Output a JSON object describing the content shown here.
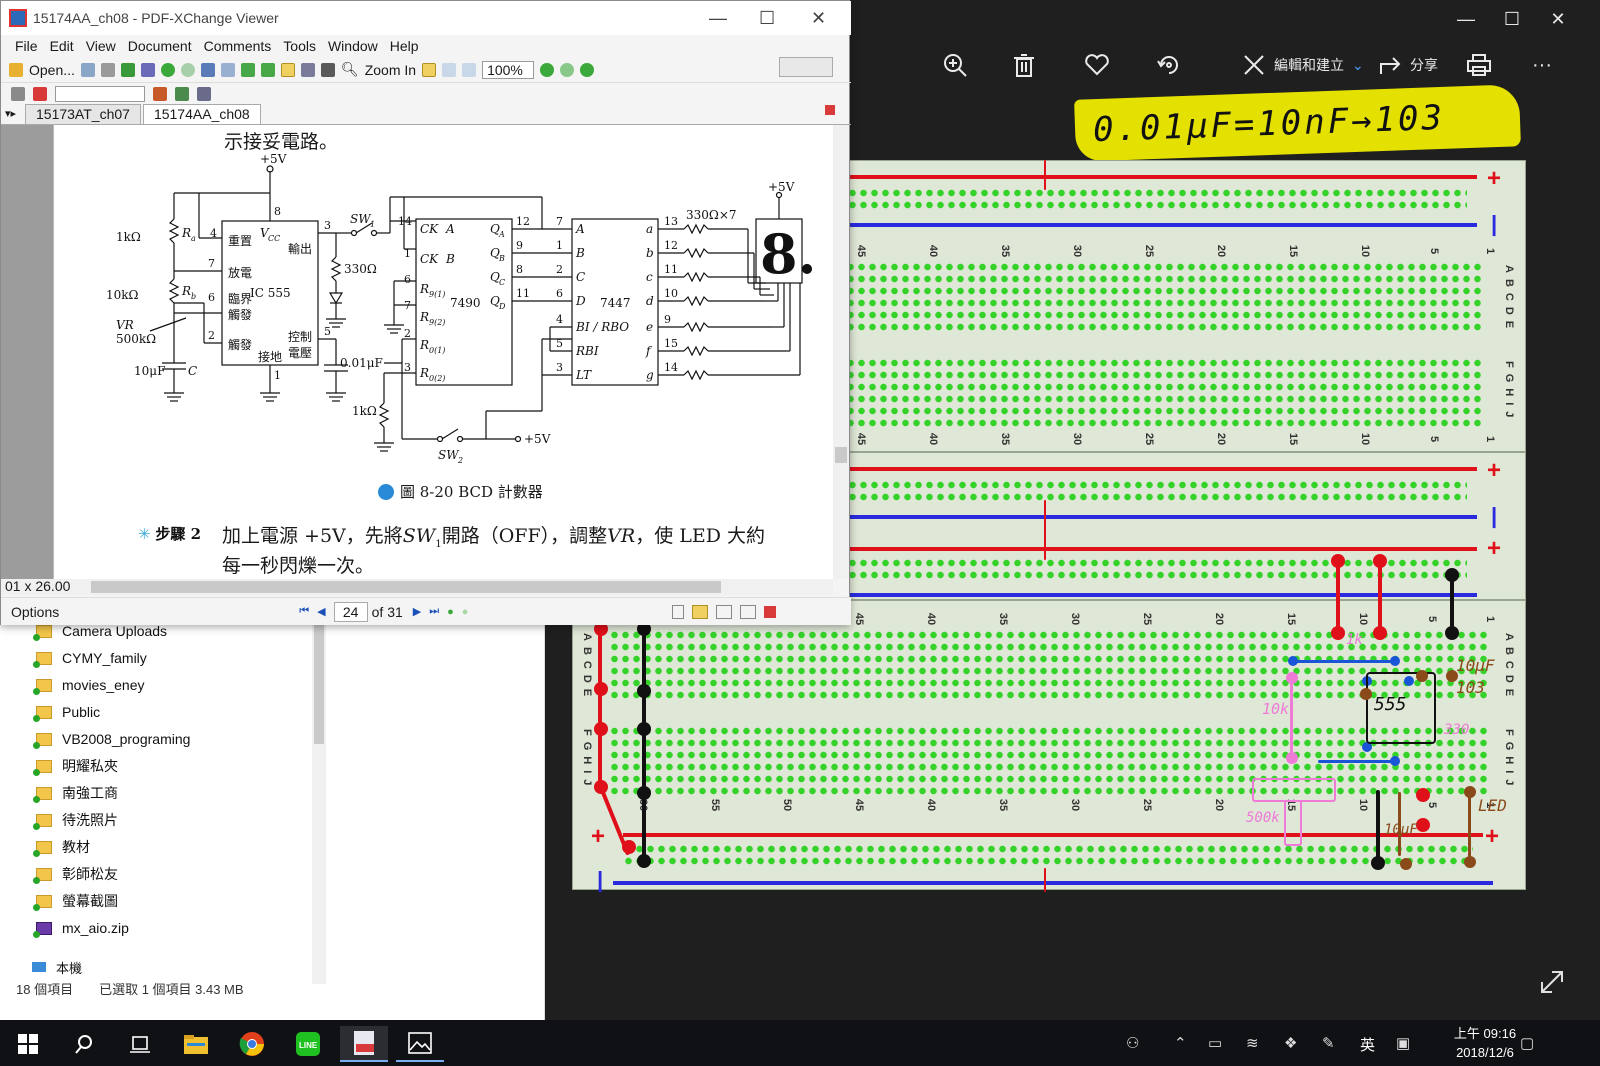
{
  "pdf": {
    "title": "15174AA_ch08 - PDF-XChange Viewer",
    "menu": [
      "File",
      "Edit",
      "View",
      "Document",
      "Comments",
      "Tools",
      "Window",
      "Help"
    ],
    "toolbar": {
      "open_label": "Open...",
      "zoom_in_label": "Zoom In",
      "zoom_value": "100%"
    },
    "tabs": [
      "15173AT_ch07",
      "15174AA_ch08"
    ],
    "doc": {
      "top_text": "示接妥電路。",
      "schematic": {
        "vcc_top": "+5V",
        "r_a": "1kΩ",
        "r_a_name": "R",
        "r_a_sub": "a",
        "r_b": "10kΩ",
        "r_b_name": "R",
        "r_b_sub": "b",
        "vr": "VR",
        "vr_value": "500kΩ",
        "cap_c": "10μF",
        "cap_c_name": "C",
        "ic555_name": "IC 555",
        "ic555_pins": {
          "reset": "重置",
          "vcc": "V",
          "vcc_sub": "CC",
          "output": "輸出",
          "discharge": "放電",
          "threshold": "臨界",
          "trigger_a": "觸發",
          "trigger_b": "觸發",
          "control": "控制",
          "voltage": "電壓",
          "ground": "接地"
        },
        "pin_numbers_555": [
          "4",
          "8",
          "3",
          "7",
          "6",
          "2",
          "5",
          "1"
        ],
        "sw1": "SW",
        "sw1_sub": "1",
        "r330": "330Ω",
        "cap001": "0.01μF",
        "ic7490_name": "7490",
        "ic7490_inputs": [
          "CK",
          "A",
          "CK",
          "B",
          "R",
          "9(1)",
          "R",
          "9(2)",
          "R",
          "0(1)",
          "R",
          "0(2)"
        ],
        "ic7490_outputs": [
          "Q",
          "A",
          "Q",
          "B",
          "Q",
          "C",
          "Q",
          "D"
        ],
        "pin_numbers_7490_in": [
          "14",
          "1",
          "6",
          "7",
          "2",
          "3"
        ],
        "pin_numbers_7490_out": [
          "12",
          "9",
          "8",
          "11"
        ],
        "ic7447_name": "7447",
        "ic7447_inputs": [
          "A",
          "B",
          "C",
          "D",
          "BI / RBO",
          "RBI",
          "LT"
        ],
        "ic7447_in_pins": [
          "7",
          "1",
          "2",
          "6",
          "4",
          "5",
          "3"
        ],
        "ic7447_outputs": [
          "a",
          "b",
          "c",
          "d",
          "e",
          "f",
          "g"
        ],
        "ic7447_out_pins": [
          "13",
          "12",
          "11",
          "10",
          "9",
          "15",
          "14"
        ],
        "r_array": "330Ω×7",
        "display_vcc": "+5V",
        "r1k": "1kΩ",
        "sw2": "SW",
        "sw2_sub": "2",
        "vcc_right": "+5V"
      },
      "figure_caption": "圖 8-20  BCD 計數器",
      "step_label": "步驟 2",
      "step_text_1a": "加上電源 +5V，先將",
      "step_text_1b": "SW",
      "step_text_1c": "1",
      "step_text_1d": "開路（OFF），調整",
      "step_text_1e": "VR",
      "step_text_1f": "，使 LED 大約",
      "step_text_2": "每一秒閃爍一次。"
    },
    "page_size": "01 x 26.00",
    "status": {
      "options_label": "Options",
      "page_current": "24",
      "page_total": "of 31"
    }
  },
  "explorer": {
    "folders": [
      "Camera Uploads",
      "CYMY_family",
      "movies_eney",
      "Public",
      "VB2008_programing",
      "明耀私夾",
      "南強工商",
      "待洗照片",
      "教材",
      "彰師松友",
      "螢幕截圖",
      "mx_aio.zip"
    ],
    "this_pc": "本機",
    "item_count": "18 個項目",
    "selected": "已選取 1 個項目  3.43 MB"
  },
  "photos": {
    "edit_label": "編輯和建立",
    "share_label": "分享",
    "handwritten_note": "0.01μF=10nF→103",
    "numbers_upper": [
      "45",
      "40",
      "35",
      "30",
      "25",
      "20",
      "15",
      "10",
      "5",
      "1"
    ],
    "numbers_lower": [
      "60",
      "55",
      "50",
      "45",
      "40",
      "35",
      "30",
      "25",
      "20",
      "15",
      "10",
      "5",
      "1"
    ],
    "letters_abcde": "ABCDE",
    "letters_fghij": "FGHIJ",
    "annotations": {
      "r1k": "1k",
      "r10k": "10k",
      "chip": "555",
      "cap103": "103",
      "cap10uf": "10μF",
      "vr500k": "500k",
      "r330": "330",
      "led": "LED",
      "cap10u_small": "10μF"
    }
  },
  "taskbar": {
    "ime": "英",
    "time": "上午 09:16",
    "date": "2018/12/6"
  }
}
